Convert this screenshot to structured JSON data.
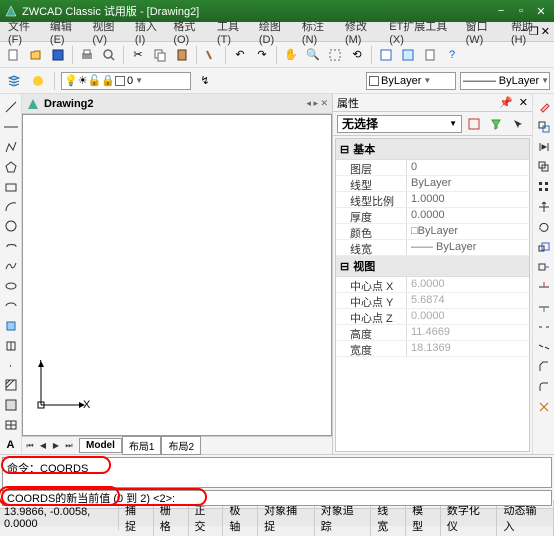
{
  "title": "ZWCAD Classic 试用版 - [Drawing2]",
  "menus": [
    "文件(F)",
    "编辑(E)",
    "视图(V)",
    "插入(I)",
    "格式(O)",
    "工具(T)",
    "绘图(D)",
    "标注(N)",
    "修改(M)",
    "ET扩展工具(X)",
    "窗口(W)",
    "帮助(H)"
  ],
  "layer_combo": "0",
  "bylayer1": "ByLayer",
  "bylayer2": "ByLayer",
  "drawing_tab": "Drawing2",
  "model_tabs": [
    "Model",
    "布局1",
    "布局2"
  ],
  "ucs_x": "X",
  "ucs_y": "Y",
  "props": {
    "title": "属性",
    "selection": "无选择",
    "groups": [
      {
        "name": "基本",
        "rows": [
          {
            "n": "图层",
            "v": "0"
          },
          {
            "n": "线型",
            "v": "ByLayer"
          },
          {
            "n": "线型比例",
            "v": "1.0000"
          },
          {
            "n": "厚度",
            "v": "0.0000"
          },
          {
            "n": "颜色",
            "v": "□ByLayer"
          },
          {
            "n": "线宽",
            "v": "—— ByLayer"
          }
        ]
      },
      {
        "name": "视图",
        "rows": [
          {
            "n": "中心点 X",
            "v": "6.0000",
            "dis": true
          },
          {
            "n": "中心点 Y",
            "v": "5.6874",
            "dis": true
          },
          {
            "n": "中心点 Z",
            "v": "0.0000",
            "dis": true
          },
          {
            "n": "高度",
            "v": "11.4669",
            "dis": true
          },
          {
            "n": "宽度",
            "v": "18.1369",
            "dis": true
          }
        ]
      }
    ]
  },
  "cmd_hist": "命令：COORDS",
  "cmd_prompt": "COORDS的新当前值 (0 到 2) <2>:",
  "status_coords": "13.9866, -0.0058, 0.0000",
  "status_btns": [
    "捕捉",
    "栅格",
    "正交",
    "极轴",
    "对象捕捉",
    "对象追踪",
    "线宽",
    "模型",
    "数字化仪",
    "动态输入"
  ]
}
